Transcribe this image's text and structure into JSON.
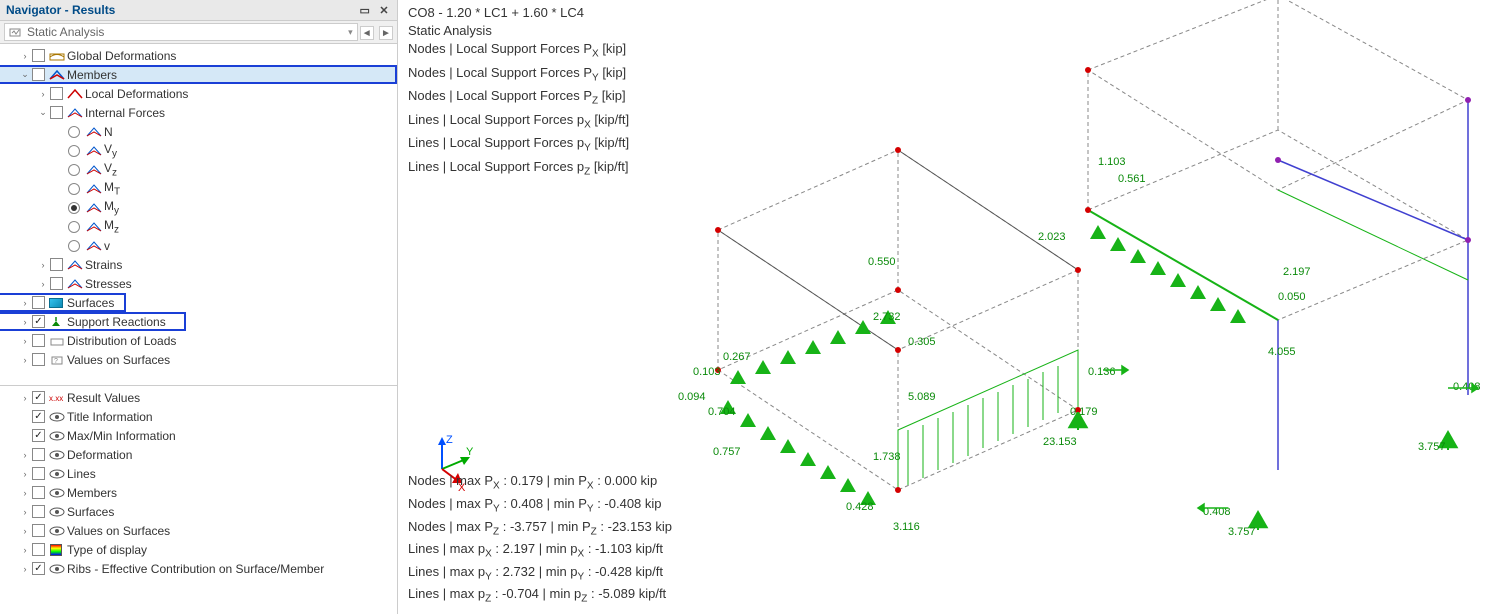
{
  "panel": {
    "title": "Navigator - Results",
    "analysis_type": "Static Analysis"
  },
  "tree": {
    "global_deformations": "Global Deformations",
    "members": "Members",
    "local_deformations": "Local Deformations",
    "internal_forces": "Internal Forces",
    "if_items": [
      "N",
      "Vy",
      "Vz",
      "MT",
      "My",
      "Mz",
      "v"
    ],
    "strains": "Strains",
    "stresses": "Stresses",
    "surfaces": "Surfaces",
    "support_reactions": "Support Reactions",
    "distribution_of_loads": "Distribution of Loads",
    "values_on_surfaces": "Values on Surfaces",
    "lower": {
      "result_values": "Result Values",
      "title_information": "Title Information",
      "maxmin_information": "Max/Min Information",
      "deformation": "Deformation",
      "lines": "Lines",
      "members": "Members",
      "surfaces": "Surfaces",
      "values_on_surfaces": "Values on Surfaces",
      "type_of_display": "Type of display",
      "ribs": "Ribs - Effective Contribution on Surface/Member"
    }
  },
  "viewport": {
    "header": {
      "combo": "CO8 - 1.20 * LC1 + 1.60 * LC4",
      "analysis": "Static Analysis",
      "lines": [
        "Nodes | Local Support Forces P<sub>X</sub> [kip]",
        "Nodes | Local Support Forces P<sub>Y</sub> [kip]",
        "Nodes | Local Support Forces P<sub>Z</sub> [kip]",
        "Lines | Local Support Forces p<sub>X</sub> [kip/ft]",
        "Lines | Local Support Forces p<sub>Y</sub> [kip/ft]",
        "Lines | Local Support Forces p<sub>Z</sub> [kip/ft]"
      ]
    },
    "footer_lines": [
      "Nodes | max P<sub>X</sub> : 0.179 | min P<sub>X</sub> : 0.000 kip",
      "Nodes | max P<sub>Y</sub> : 0.408 | min P<sub>Y</sub> : -0.408 kip",
      "Nodes | max P<sub>Z</sub> : -3.757 | min P<sub>Z</sub> : -23.153 kip",
      "Lines | max p<sub>X</sub> : 2.197 | min p<sub>X</sub> : -1.103 kip/ft",
      "Lines | max p<sub>Y</sub> : 2.732 | min p<sub>Y</sub> : -0.428 kip/ft",
      "Lines | max p<sub>Z</sub> : -0.704 | min p<sub>Z</sub> : -5.089 kip/ft"
    ],
    "axis_labels": {
      "x": "X",
      "y": "Y",
      "z": "Z"
    },
    "model_values": {
      "v1": "1.103",
      "v2": "0.561",
      "v3": "2.023",
      "v4": "2.197",
      "v5": "0.050",
      "v6": "0.550",
      "v7": "2.732",
      "v8": "0.305",
      "v9": "4.055",
      "v10": "0.136",
      "v11": "0.179",
      "v12": "5.089",
      "v13": "0.267",
      "v14": "0.103",
      "v15": "0.094",
      "v16": "0.704",
      "v17": "0.757",
      "v18": "1.738",
      "v19": "0.428",
      "v20": "3.116",
      "v21": "23.153",
      "v22": "0.408",
      "v23": "0.408",
      "v24": "3.757",
      "v25": "3.757"
    }
  }
}
